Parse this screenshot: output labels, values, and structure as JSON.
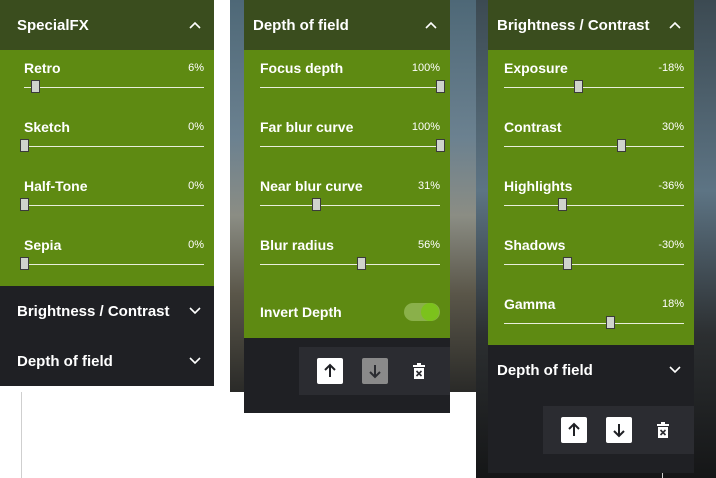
{
  "panel_specialfx": {
    "title": "SpecialFX",
    "sliders": [
      {
        "label": "Retro",
        "value": "6%",
        "fraction": 0.06
      },
      {
        "label": "Sketch",
        "value": "0%",
        "fraction": 0.0
      },
      {
        "label": "Half-Tone",
        "value": "0%",
        "fraction": 0.0
      },
      {
        "label": "Sepia",
        "value": "0%",
        "fraction": 0.0
      }
    ],
    "collapsed": [
      "Brightness / Contrast",
      "Depth of field"
    ]
  },
  "panel_dof": {
    "title": "Depth of field",
    "sliders": [
      {
        "label": "Focus depth",
        "value": "100%",
        "fraction": 1.0
      },
      {
        "label": "Far blur curve",
        "value": "100%",
        "fraction": 1.0
      },
      {
        "label": "Near blur curve",
        "value": "31%",
        "fraction": 0.31
      },
      {
        "label": "Blur radius",
        "value": "56%",
        "fraction": 0.56
      }
    ],
    "toggle": {
      "label": "Invert Depth",
      "on": true
    }
  },
  "panel_bc": {
    "title": "Brightness / Contrast",
    "sliders": [
      {
        "label": "Exposure",
        "value": "-18%",
        "fraction": 0.41
      },
      {
        "label": "Contrast",
        "value": "30%",
        "fraction": 0.65
      },
      {
        "label": "Highlights",
        "value": "-36%",
        "fraction": 0.32
      },
      {
        "label": "Shadows",
        "value": "-30%",
        "fraction": 0.35
      },
      {
        "label": "Gamma",
        "value": "18%",
        "fraction": 0.59
      }
    ],
    "collapsed": [
      "Depth of field"
    ]
  },
  "icons": {
    "chevron_up": "chevron-up-icon",
    "chevron_down": "chevron-down-icon",
    "move_up": "arrow-up-icon",
    "move_down": "arrow-down-icon",
    "delete": "trash-icon"
  },
  "colors": {
    "panel_bg": "#1f2024",
    "header_open": "#3a4d1e",
    "accent_green": "#5e8a12",
    "toggle_knob": "#7cc21c"
  }
}
